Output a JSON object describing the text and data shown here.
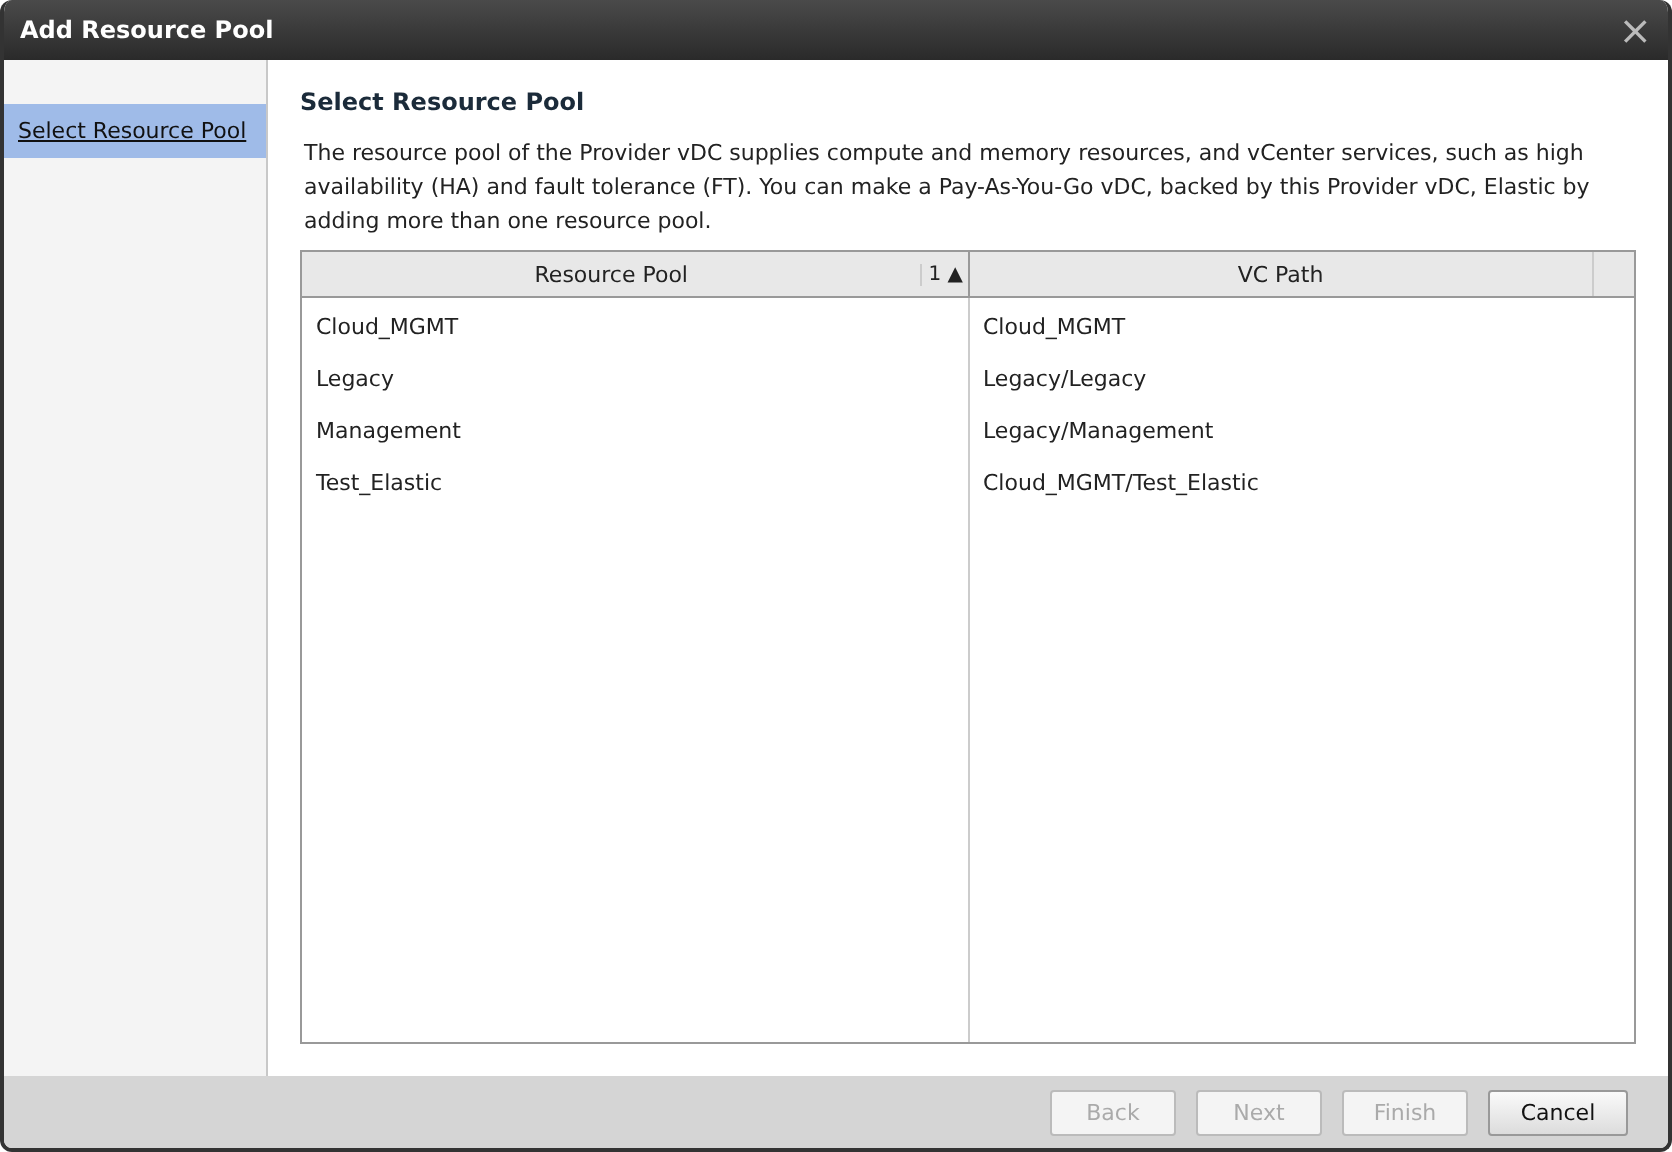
{
  "window": {
    "title": "Add Resource Pool",
    "close": "×"
  },
  "sidebar": {
    "items": [
      {
        "label": "Select Resource Pool",
        "selected": true
      }
    ]
  },
  "heading": "Select Resource Pool",
  "description": "The resource pool of the Provider vDC supplies compute and memory resources, and vCenter services, such as high availability (HA) and fault tolerance (FT). You can make a Pay-As-You-Go vDC, backed by this Provider vDC, Elastic by adding more than one resource pool.",
  "table": {
    "columns": [
      {
        "label": "Resource Pool",
        "sort_rank": "1",
        "sort_arrow": "▲"
      },
      {
        "label": "VC Path"
      }
    ],
    "rows": [
      [
        "Cloud_MGMT",
        "Cloud_MGMT"
      ],
      [
        "Legacy",
        "Legacy/Legacy"
      ],
      [
        "Management",
        "Legacy/Management"
      ],
      [
        "Test_Elastic",
        "Cloud_MGMT/Test_Elastic"
      ]
    ]
  },
  "buttons": [
    {
      "label": "Back",
      "disabled": true
    },
    {
      "label": "Next",
      "disabled": true
    },
    {
      "label": "Finish",
      "disabled": true
    },
    {
      "label": "Cancel",
      "disabled": false
    }
  ]
}
